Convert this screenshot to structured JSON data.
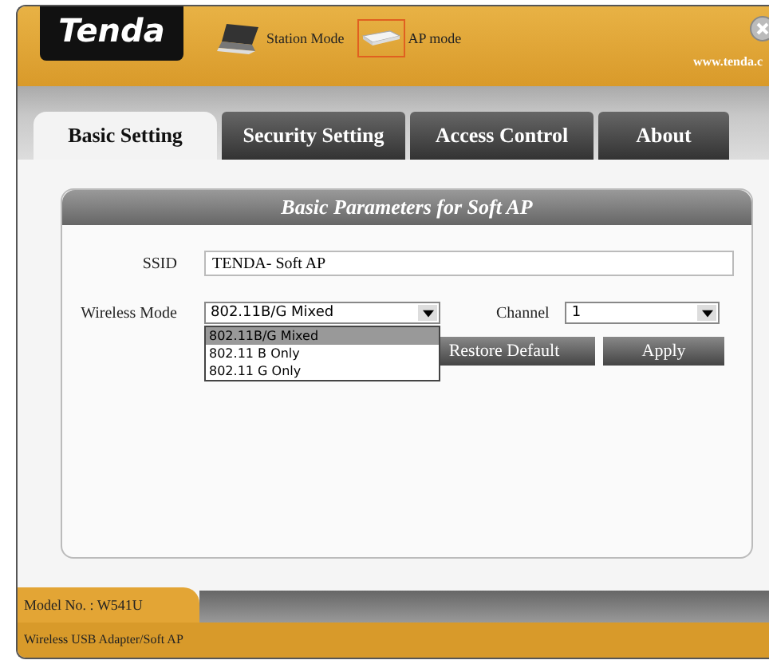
{
  "header": {
    "logo": "Tenda",
    "url": "www.tenda.c",
    "modes": [
      {
        "label": "Station Mode",
        "kind": "station",
        "selected": false
      },
      {
        "label": "AP mode",
        "kind": "ap",
        "selected": true
      }
    ]
  },
  "tabs": [
    {
      "label": "Basic Setting",
      "selected": true
    },
    {
      "label": "Security Setting",
      "selected": false
    },
    {
      "label": "Access Control",
      "selected": false
    },
    {
      "label": "About",
      "selected": false
    }
  ],
  "panel": {
    "title": "Basic Parameters for Soft AP",
    "ssid": {
      "label": "SSID",
      "value": "TENDA- Soft AP"
    },
    "wireless_mode": {
      "label": "Wireless Mode",
      "value": "802.11B/G Mixed",
      "expanded": true,
      "options": [
        {
          "label": "802.11B/G Mixed",
          "selected": true
        },
        {
          "label": "802.11 B Only",
          "selected": false
        },
        {
          "label": "802.11 G Only",
          "selected": false
        }
      ]
    },
    "channel": {
      "label": "Channel",
      "value": "1"
    },
    "buttons": [
      "Restore Default",
      "Apply"
    ]
  },
  "footer": {
    "model": "Model No. : W541U",
    "description": "Wireless USB Adapter/Soft AP"
  }
}
